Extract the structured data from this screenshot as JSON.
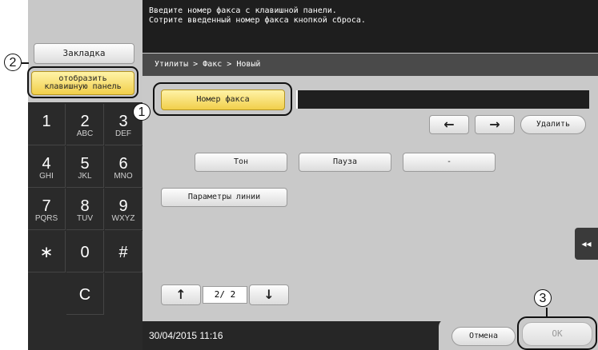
{
  "instructions": {
    "line1": "Введите номер факса с клавишной панели.",
    "line2": "Сотрите введенный номер факса кнопкой сброса."
  },
  "left_panel": {
    "bookmark_label": "Закладка",
    "show_keypad_line1": "отобразить",
    "show_keypad_line2": "клавишную панель"
  },
  "keypad": {
    "keys": [
      {
        "digit": "1",
        "letters": ""
      },
      {
        "digit": "2",
        "letters": "ABC"
      },
      {
        "digit": "3",
        "letters": "DEF"
      },
      {
        "digit": "4",
        "letters": "GHI"
      },
      {
        "digit": "5",
        "letters": "JKL"
      },
      {
        "digit": "6",
        "letters": "MNO"
      },
      {
        "digit": "7",
        "letters": "PQRS"
      },
      {
        "digit": "8",
        "letters": "TUV"
      },
      {
        "digit": "9",
        "letters": "WXYZ"
      },
      {
        "digit": "∗",
        "letters": ""
      },
      {
        "digit": "0",
        "letters": ""
      },
      {
        "digit": "#",
        "letters": ""
      },
      {
        "digit": "C",
        "letters": ""
      }
    ]
  },
  "breadcrumb": "Утилиты > Факс > Новый",
  "fax_number_label": "Номер факса",
  "fax_number_value": "",
  "nav": {
    "left_arrow": "←",
    "right_arrow": "→",
    "delete_label": "Удалить"
  },
  "dial_buttons": {
    "tone": "Тон",
    "pause": "Пауза",
    "dash": "-",
    "line_params": "Параметры линии"
  },
  "collapse_icon": "◂◂",
  "pagination": {
    "up": "↑",
    "down": "↓",
    "indicator": "2/ 2"
  },
  "datetime": "30/04/2015  11:16",
  "footer": {
    "cancel_label": "Отмена",
    "ok_label": "OK"
  },
  "callouts": {
    "one": "1",
    "two": "2",
    "three": "3"
  }
}
